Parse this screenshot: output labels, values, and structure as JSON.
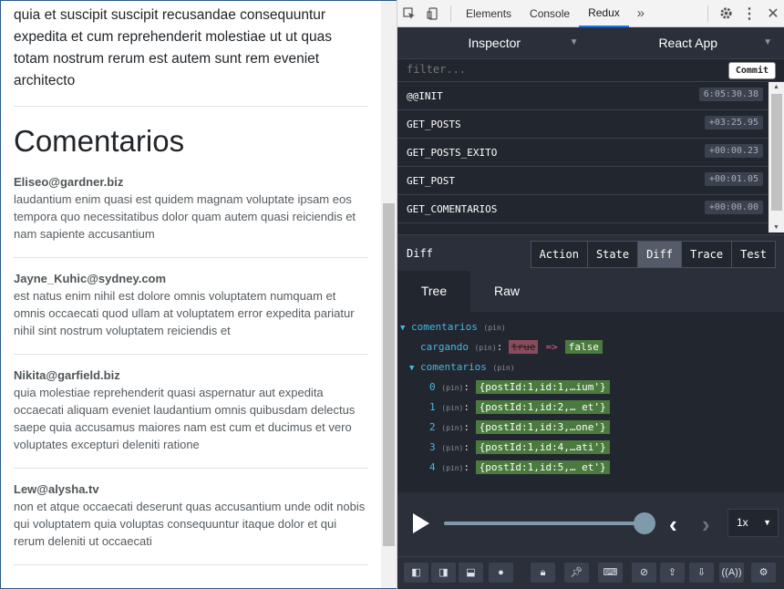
{
  "page": {
    "intro_text": "quia et suscipit suscipit recusandae consequuntur expedita et cum reprehenderit molestiae ut ut quas totam nostrum rerum est autem sunt rem eveniet architecto",
    "heading": "Comentarios",
    "comments": [
      {
        "email": "Eliseo@gardner.biz",
        "body": "laudantium enim quasi est quidem magnam voluptate ipsam eos tempora quo necessitatibus dolor quam autem quasi reiciendis et nam sapiente accusantium"
      },
      {
        "email": "Jayne_Kuhic@sydney.com",
        "body": "est natus enim nihil est dolore omnis voluptatem numquam et omnis occaecati quod ullam at voluptatem error expedita pariatur nihil sint nostrum voluptatem reiciendis et"
      },
      {
        "email": "Nikita@garfield.biz",
        "body": "quia molestiae reprehenderit quasi aspernatur aut expedita occaecati aliquam eveniet laudantium omnis quibusdam delectus saepe quia accusamus maiores nam est cum et ducimus et vero voluptates excepturi deleniti ratione"
      },
      {
        "email": "Lew@alysha.tv",
        "body": "non et atque occaecati deserunt quas accusantium unde odit nobis qui voluptatem quia voluptas consequuntur itaque dolor et qui rerum deleniti ut occaecati"
      }
    ]
  },
  "devtools": {
    "tabs": [
      "Elements",
      "Console",
      "Redux"
    ],
    "active_tab": "Redux",
    "more_icon": "double-chevron-icon"
  },
  "redux": {
    "instance_selector": "Inspector",
    "app_selector": "React App",
    "filter_placeholder": "filter...",
    "commit_label": "Commit",
    "actions": [
      {
        "name": "@@INIT",
        "time": "6:05:30.38"
      },
      {
        "name": "GET_POSTS",
        "time": "+03:25.95"
      },
      {
        "name": "GET_POSTS_EXITO",
        "time": "+00:00.23"
      },
      {
        "name": "GET_POST",
        "time": "+00:01.05"
      },
      {
        "name": "GET_COMENTARIOS",
        "time": "+00:00.00"
      }
    ],
    "monitor_title": "Diff",
    "monitor_tabs": [
      "Action",
      "State",
      "Diff",
      "Trace",
      "Test"
    ],
    "active_monitor_tab": "Diff",
    "view_tabs": [
      "Tree",
      "Raw"
    ],
    "active_view_tab": "Tree",
    "tree": {
      "root_key": "comentarios",
      "pin": "(pin)",
      "cargando_key": "cargando",
      "cargando_old": "true",
      "cargando_new": "false",
      "change_arrow": "=>",
      "list_key": "comentarios",
      "items": [
        {
          "index": "0",
          "value": "{postId:1,id:1,…ium'}"
        },
        {
          "index": "1",
          "value": "{postId:1,id:2,… et'}"
        },
        {
          "index": "2",
          "value": "{postId:1,id:3,…one'}"
        },
        {
          "index": "3",
          "value": "{postId:1,id:4,…ati'}"
        },
        {
          "index": "4",
          "value": "{postId:1,id:5,… et'}"
        }
      ]
    },
    "player": {
      "speed": "1x",
      "slider_position": 1.0
    },
    "colors": {
      "added": "#4b7a3e",
      "removed": "#8a4c5c",
      "key": "#45b8e6"
    }
  }
}
